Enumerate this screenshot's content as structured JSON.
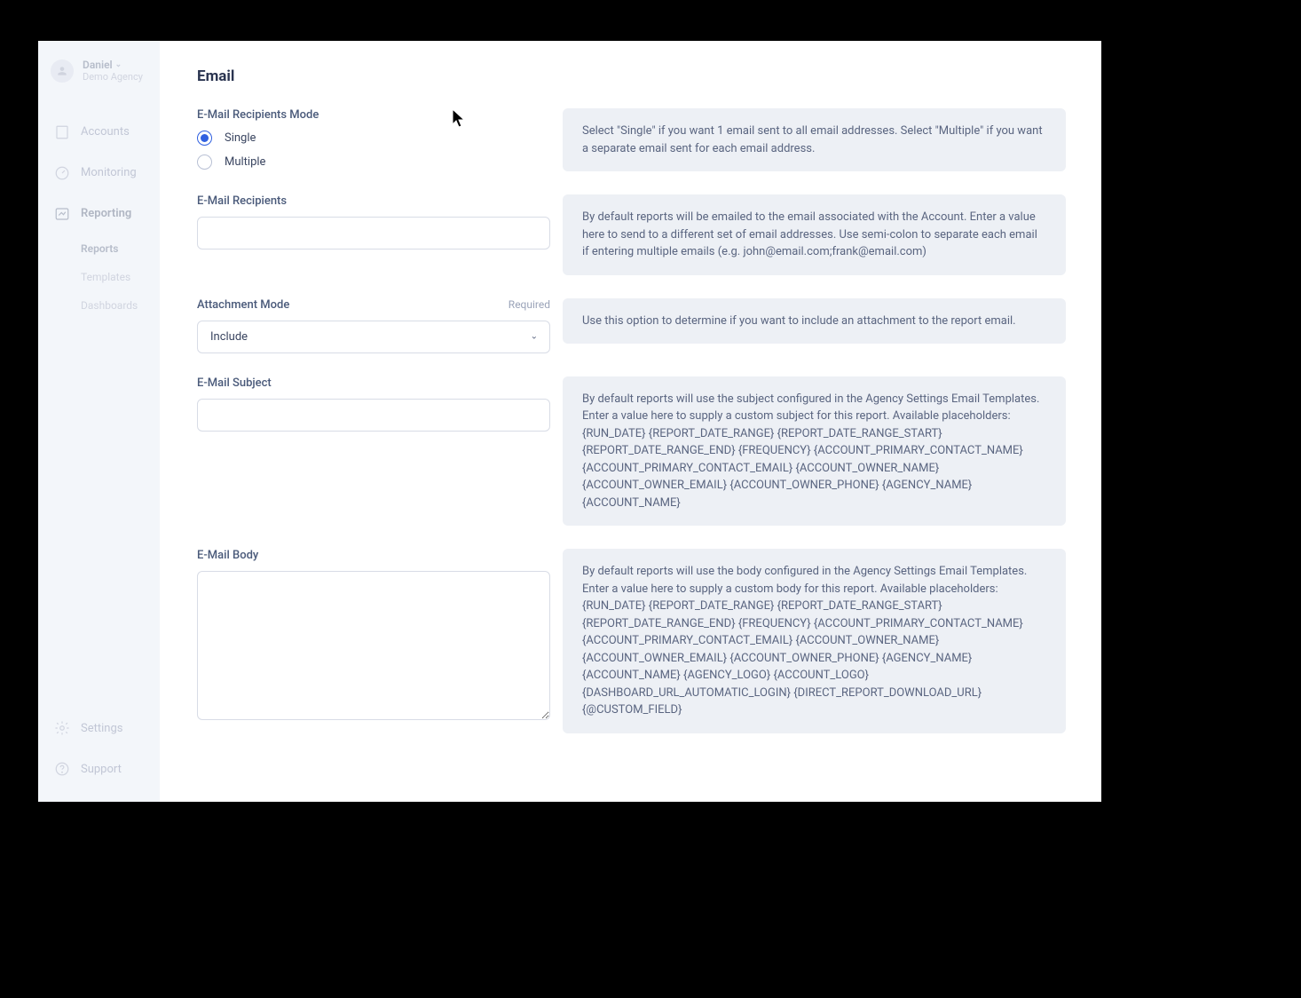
{
  "user": {
    "name": "Daniel",
    "agency": "Demo Agency"
  },
  "sidebar": {
    "items": [
      {
        "label": "Accounts"
      },
      {
        "label": "Monitoring"
      },
      {
        "label": "Reporting"
      }
    ],
    "subitems": [
      {
        "label": "Reports"
      },
      {
        "label": "Templates"
      },
      {
        "label": "Dashboards"
      }
    ],
    "bottom": [
      {
        "label": "Settings"
      },
      {
        "label": "Support"
      }
    ]
  },
  "form": {
    "title": "Email",
    "recipients_mode": {
      "label": "E-Mail Recipients Mode",
      "options": [
        {
          "value": "single",
          "label": "Single",
          "selected": true
        },
        {
          "value": "multiple",
          "label": "Multiple",
          "selected": false
        }
      ],
      "help": "Select \"Single\" if you want 1 email sent to all email addresses. Select \"Multiple\" if you want a separate email sent for each email address."
    },
    "recipients": {
      "label": "E-Mail Recipients",
      "value": "",
      "help": "By default reports will be emailed to the email associated with the Account. Enter a value here to send to a different set of email addresses. Use semi-colon to separate each email if entering multiple emails (e.g. john@email.com;frank@email.com)"
    },
    "attachment_mode": {
      "label": "Attachment Mode",
      "required": "Required",
      "value": "Include",
      "help": "Use this option to determine if you want to include an attachment to the report email."
    },
    "subject": {
      "label": "E-Mail Subject",
      "value": "",
      "help": "By default reports will use the subject configured in the Agency Settings Email Templates. Enter a value here to supply a custom subject for this report. Available placeholders: {RUN_DATE} {REPORT_DATE_RANGE} {REPORT_DATE_RANGE_START} {REPORT_DATE_RANGE_END} {FREQUENCY} {ACCOUNT_PRIMARY_CONTACT_NAME} {ACCOUNT_PRIMARY_CONTACT_EMAIL} {ACCOUNT_OWNER_NAME} {ACCOUNT_OWNER_EMAIL} {ACCOUNT_OWNER_PHONE} {AGENCY_NAME} {ACCOUNT_NAME}"
    },
    "body": {
      "label": "E-Mail Body",
      "value": "",
      "help": "By default reports will use the body configured in the Agency Settings Email Templates. Enter a value here to supply a custom body for this report. Available placeholders: {RUN_DATE} {REPORT_DATE_RANGE} {REPORT_DATE_RANGE_START} {REPORT_DATE_RANGE_END} {FREQUENCY} {ACCOUNT_PRIMARY_CONTACT_NAME} {ACCOUNT_PRIMARY_CONTACT_EMAIL} {ACCOUNT_OWNER_NAME} {ACCOUNT_OWNER_EMAIL} {ACCOUNT_OWNER_PHONE} {AGENCY_NAME} {ACCOUNT_NAME} {AGENCY_LOGO} {ACCOUNT_LOGO} {DASHBOARD_URL_AUTOMATIC_LOGIN} {DIRECT_REPORT_DOWNLOAD_URL} {@CUSTOM_FIELD}"
    }
  }
}
